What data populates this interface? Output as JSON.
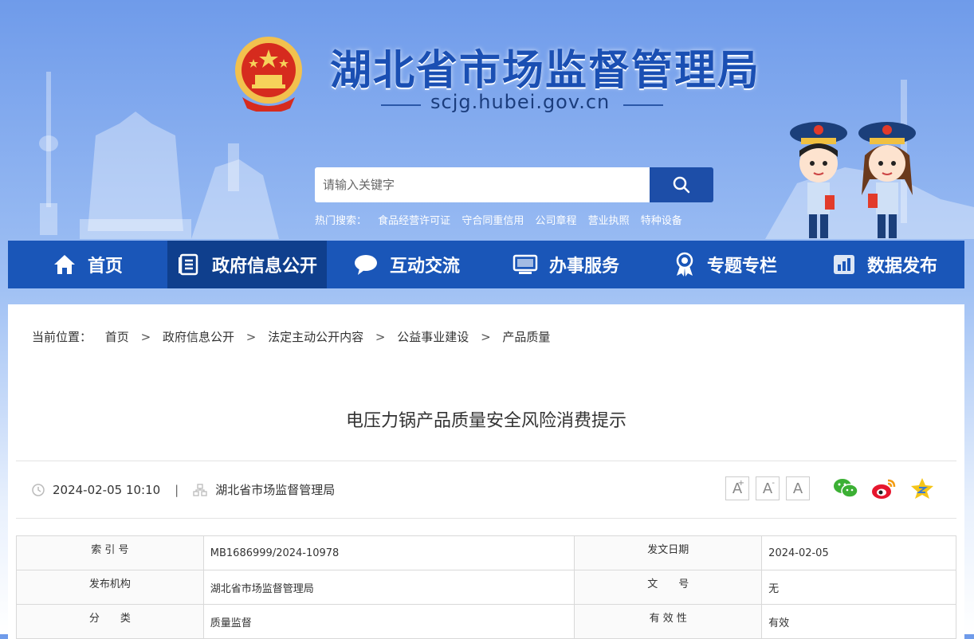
{
  "header": {
    "site_title": "湖北省市场监督管理局",
    "site_domain": "scjg.hubei.gov.cn",
    "emblem_icon": "national-emblem-icon",
    "search": {
      "placeholder": "请输入关键字",
      "button_icon": "search-icon"
    },
    "hot_search": {
      "label": "热门搜索：",
      "terms": [
        "食品经营许可证",
        "守合同重信用",
        "公司章程",
        "营业执照",
        "特种设备"
      ]
    }
  },
  "nav": {
    "items": [
      {
        "label": "首页",
        "icon": "home-icon"
      },
      {
        "label": "政府信息公开",
        "icon": "document-icon",
        "active": true
      },
      {
        "label": "互动交流",
        "icon": "chat-bubble-icon"
      },
      {
        "label": "办事服务",
        "icon": "monitor-icon"
      },
      {
        "label": "专题专栏",
        "icon": "medal-icon"
      },
      {
        "label": "数据发布",
        "icon": "bar-chart-icon"
      }
    ]
  },
  "breadcrumb": {
    "label": "当前位置：",
    "items": [
      "首页",
      "政府信息公开",
      "法定主动公开内容",
      "公益事业建设",
      "产品质量"
    ],
    "separator": ">"
  },
  "article": {
    "title": "电压力锅产品质量安全风险消费提示",
    "datetime": "2024-02-05 10:10",
    "divider": "|",
    "source": "湖北省市场监督管理局",
    "font_buttons": [
      "A",
      "A",
      "A"
    ],
    "font_button_marks": [
      "+",
      "-"
    ],
    "share_icons": [
      "wechat-icon",
      "weibo-icon",
      "favorite-star-icon"
    ]
  },
  "info_table": {
    "rows": [
      {
        "k1": "索 引 号",
        "v1": "MB1686999/2024-10978",
        "k2": "发文日期",
        "v2": "2024-02-05"
      },
      {
        "k1": "发布机构",
        "v1": "湖北省市场监督管理局",
        "k2": "文　　号",
        "v2": "无"
      },
      {
        "k1": "分　　类",
        "v1": "质量监督",
        "k2": "有 效 性",
        "v2": "有效"
      }
    ]
  },
  "colors": {
    "nav_bg": "#1a56b8",
    "nav_active": "#0f3f8d",
    "title_blue": "#1a4fb3",
    "search_button": "#1d4ea8"
  }
}
